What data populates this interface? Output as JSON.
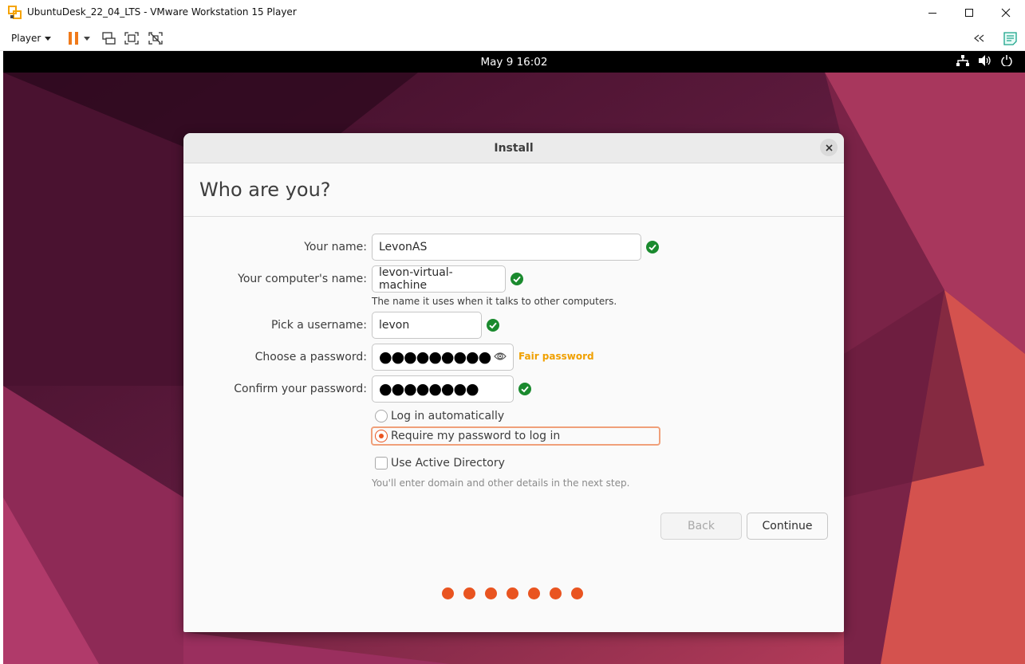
{
  "host_window": {
    "title": "UbuntuDesk_22_04_LTS - VMware Workstation 15 Player",
    "player_menu_label": "Player"
  },
  "guest_top_bar": {
    "clock": "May 9  16:02"
  },
  "install_dialog": {
    "window_title": "Install",
    "heading": "Who are you?",
    "fields": {
      "your_name": {
        "label": "Your name:",
        "value": "LevonAS"
      },
      "computer_name": {
        "label": "Your computer's name:",
        "value": "levon-virtual-machine",
        "hint": "The name it uses when it talks to other computers."
      },
      "username": {
        "label": "Pick a username:",
        "value": "levon"
      },
      "password": {
        "label": "Choose a password:",
        "value": "●●●●●●●●●",
        "strength": "Fair password"
      },
      "confirm_password": {
        "label": "Confirm your password:",
        "value": "●●●●●●●●"
      }
    },
    "login_options": {
      "auto_login_label": "Log in automatically",
      "require_password_label": "Require my password to log in",
      "selected": "require_password"
    },
    "active_directory": {
      "label": "Use Active Directory",
      "checked": false,
      "hint": "You'll enter domain and other details in the next step."
    },
    "buttons": {
      "back": "Back",
      "continue": "Continue"
    },
    "progress_steps": 7
  },
  "colors": {
    "ubuntu_orange": "#e95420",
    "success_green": "#1a8a2e",
    "strength_fair": "#f0a000"
  }
}
